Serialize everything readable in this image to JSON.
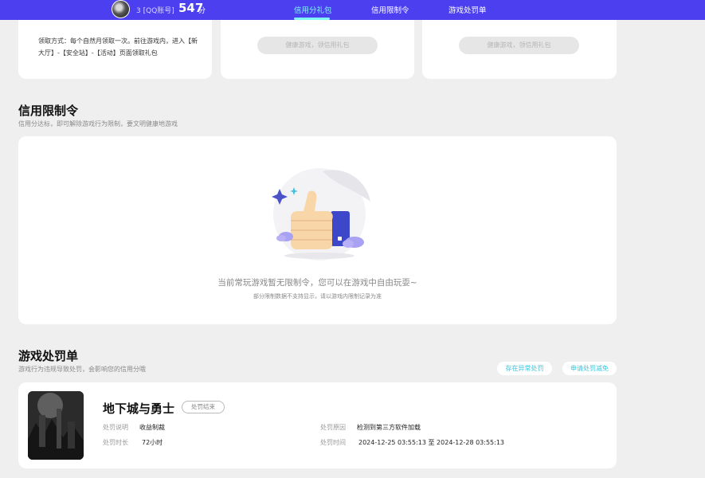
{
  "header": {
    "account_prefix": "3",
    "account_type": "[QQ账号]",
    "score": "547",
    "score_unit": "分",
    "tabs": [
      {
        "label": "信用分礼包",
        "active": true
      },
      {
        "label": "信用限制令",
        "active": false
      },
      {
        "label": "游戏处罚单",
        "active": false
      }
    ]
  },
  "gift_cards": {
    "claim_text": "领取方式：每个自然月领取一次。前往游戏内，进入【新大厅】-【安全站】-【活动】页面领取礼包",
    "disabled_button_2": "健康游戏，领信用礼包",
    "disabled_button_3": "健康游戏，领信用礼包"
  },
  "restriction": {
    "title": "信用限制令",
    "subtitle": "信用分达标，即可解除游戏行为限制，要文明健康地游戏",
    "empty_message": "当前常玩游戏暂无限制令，您可以在游戏中自由玩耍~",
    "empty_note": "部分限制数据不支持显示，请以游戏内限制记录为准"
  },
  "penalty": {
    "title": "游戏处罚单",
    "subtitle": "游戏行为违规导致处罚，会影响您的信用分哦",
    "btn_abnormal": "存在异常处罚",
    "btn_appeal": "申请处罚减免",
    "item": {
      "game": "地下城与勇士",
      "status": "处罚结束",
      "desc_label": "处罚说明",
      "desc_value": "收益制裁",
      "reason_label": "处罚原因",
      "reason_value": "检测到第三方软件加载",
      "duration_label": "处罚时长",
      "duration_value": "72小时",
      "time_label": "处罚时间",
      "time_value": "2024-12-25 03:55:13 至 2024-12-28 03:55:13"
    }
  },
  "colors": {
    "header_bg": "#4b3ff0",
    "tab_active": "#7ef6f4",
    "pill_text": "#39c6de",
    "page_bg": "#efefef"
  }
}
